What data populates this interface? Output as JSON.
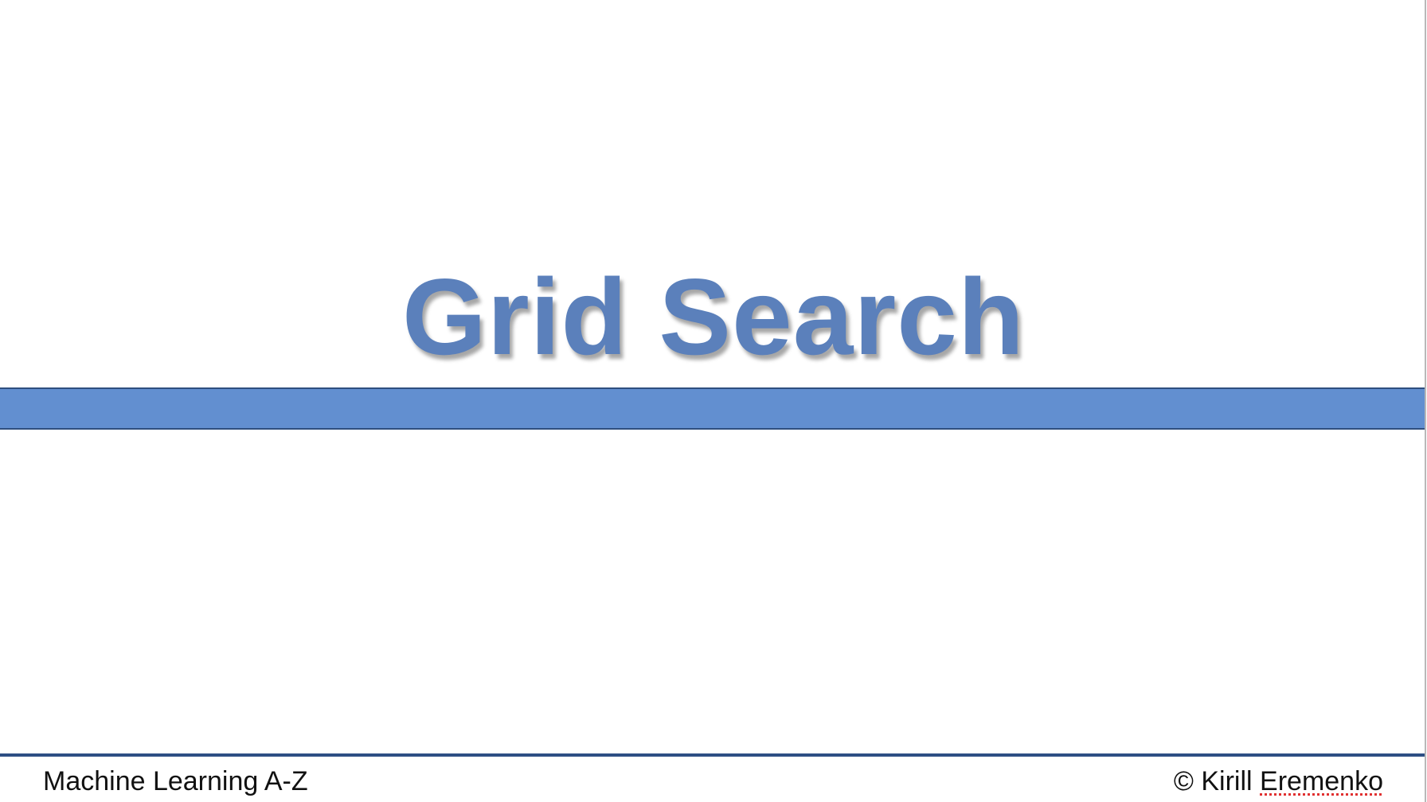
{
  "slide": {
    "title": "Grid Search",
    "footer": {
      "left": "Machine Learning A-Z",
      "right_prefix": "© Kirill ",
      "right_surname": "Eremenko"
    }
  },
  "colors": {
    "title": "#5b80bb",
    "band": "#628fd0",
    "band_border": "#2f4f7f",
    "footer_line": "#2d4f84",
    "spellcheck_underline": "#e03030"
  }
}
